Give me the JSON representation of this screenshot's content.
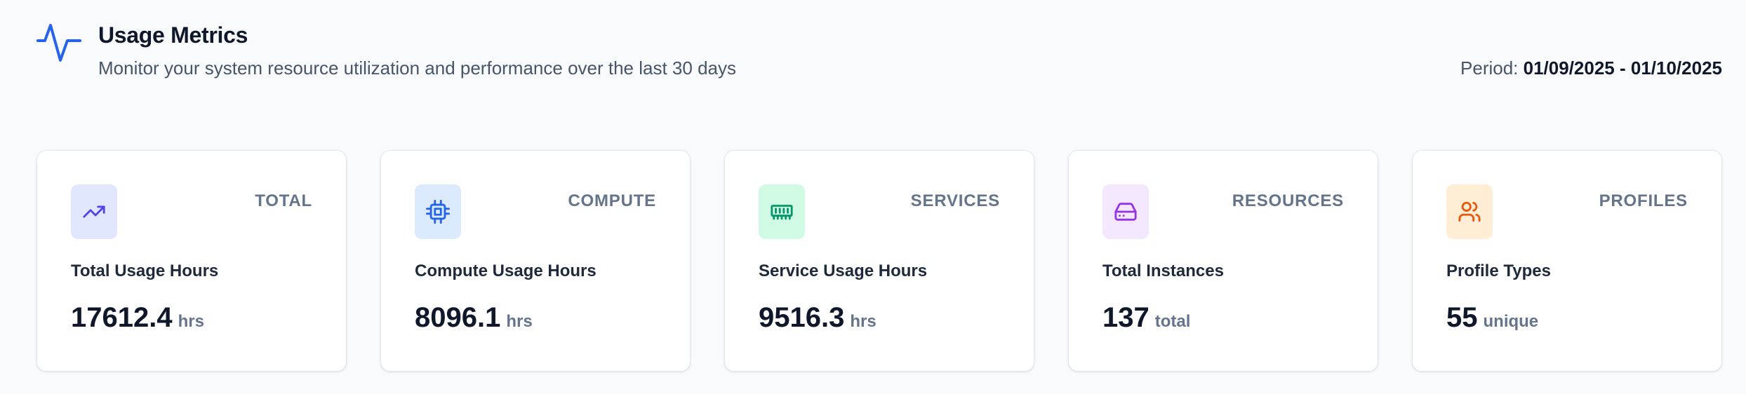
{
  "header": {
    "icon": "activity-icon",
    "title": "Usage Metrics",
    "subtitle": "Monitor your system resource utilization and performance over the last 30 days",
    "period_label": "Period:",
    "period_value": "01/09/2025 - 01/10/2025"
  },
  "colors": {
    "accent": "#2563eb",
    "total_icon": "#4f46e5",
    "total_bg": "#e0e7ff",
    "compute_icon": "#2563eb",
    "compute_bg": "#dbeafe",
    "services_icon": "#059669",
    "services_bg": "#d1fae5",
    "resources_icon": "#9333ea",
    "resources_bg": "#f3e8ff",
    "profiles_icon": "#ea580c",
    "profiles_bg": "#ffedd5"
  },
  "cards": [
    {
      "icon": "trending-up-icon",
      "tag": "TOTAL",
      "label": "Total Usage Hours",
      "value": "17612.4",
      "unit": "hrs"
    },
    {
      "icon": "cpu-icon",
      "tag": "COMPUTE",
      "label": "Compute Usage Hours",
      "value": "8096.1",
      "unit": "hrs"
    },
    {
      "icon": "memory-stick-icon",
      "tag": "SERVICES",
      "label": "Service Usage Hours",
      "value": "9516.3",
      "unit": "hrs"
    },
    {
      "icon": "hard-drive-icon",
      "tag": "RESOURCES",
      "label": "Total Instances",
      "value": "137",
      "unit": "total"
    },
    {
      "icon": "users-icon",
      "tag": "PROFILES",
      "label": "Profile Types",
      "value": "55",
      "unit": "unique"
    }
  ]
}
